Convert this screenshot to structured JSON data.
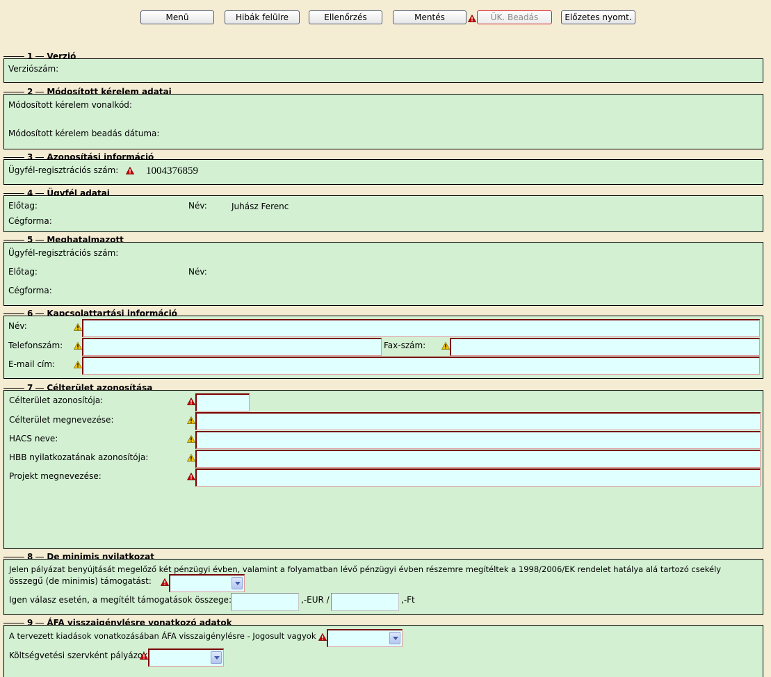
{
  "toolbar": {
    "menu": "Menü",
    "errors_top": "Hibák felülre",
    "check": "Ellenőrzés",
    "save": "Mentés",
    "submit": "ÜK. Beadás",
    "preview": "Előzetes nyomt."
  },
  "sections": {
    "s1": {
      "num": "1",
      "title": "Verzió",
      "version_label": "Verziószám:"
    },
    "s2": {
      "num": "2",
      "title": "Módosított kérelem adatai",
      "barcode_label": "Módosított kérelem vonalkód:",
      "date_label": "Módosított kérelem beadás dátuma:"
    },
    "s3": {
      "num": "3",
      "title": "Azonosítási információ",
      "client_reg_label": "Ügyfél-regisztrációs szám:",
      "client_reg_value": "1004376859"
    },
    "s4": {
      "num": "4",
      "title": "Ügyfél adatai",
      "prefix_label": "Előtag:",
      "name_label": "Név:",
      "name_value": "Juhász Ferenc",
      "company_form_label": "Cégforma:"
    },
    "s5": {
      "num": "5",
      "title": "Meghatalmazott",
      "client_reg_label": "Ügyfél-regisztrációs szám:",
      "prefix_label": "Előtag:",
      "name_label": "Név:",
      "company_form_label": "Cégforma:"
    },
    "s6": {
      "num": "6",
      "title": "Kapcsolattartási információ",
      "name_label": "Név:",
      "phone_label": "Telefonszám:",
      "fax_label": "Fax-szám:",
      "email_label": "E-mail cím:"
    },
    "s7": {
      "num": "7",
      "title": "Célterület azonosítása",
      "area_id_label": "Célterület azonosítója:",
      "area_name_label": "Célterület megnevezése:",
      "hacs_label": "HACS neve:",
      "hbb_label": "HBB nyilatkozatának azonosítója:",
      "project_label": "Projekt megnevezése:"
    },
    "s8": {
      "num": "8",
      "title": "De minimis nyilatkozat",
      "text1": "Jelen pályázat benyújtását megelőző két pénzügyi évben, valamint a folyamatban lévő pénzügyi évben részemre megítéltek a 1998/2006/EK rendelet hatálya alá tartozó csekély",
      "text2": "összegű (de minimis) támogatást:",
      "amount_label": "Igen válasz esetén, a megítélt támogatások összege:",
      "eur_suffix": ",-EUR /",
      "ft_suffix": ",-Ft"
    },
    "s9": {
      "num": "9",
      "title": "ÁFA visszaigénylésre vonatkozó adatok",
      "vat_label": "A tervezett kiadások vonatkozásában ÁFA visszaigénylésre - Jogosult vagyok",
      "budget_label": "Költségvetési szervként pályázok"
    }
  },
  "colors": {
    "page_bg": "#f5ecd4",
    "section_bg": "#d3f0d3",
    "input_bg": "#e0ffff",
    "required_border": "#7a0000",
    "warning_red": "#cc0000",
    "warning_yellow": "#f2c200"
  },
  "icons": {
    "required": "warning-red-icon",
    "optional": "warning-yellow-icon",
    "dropdown": "chevron-down-icon"
  }
}
